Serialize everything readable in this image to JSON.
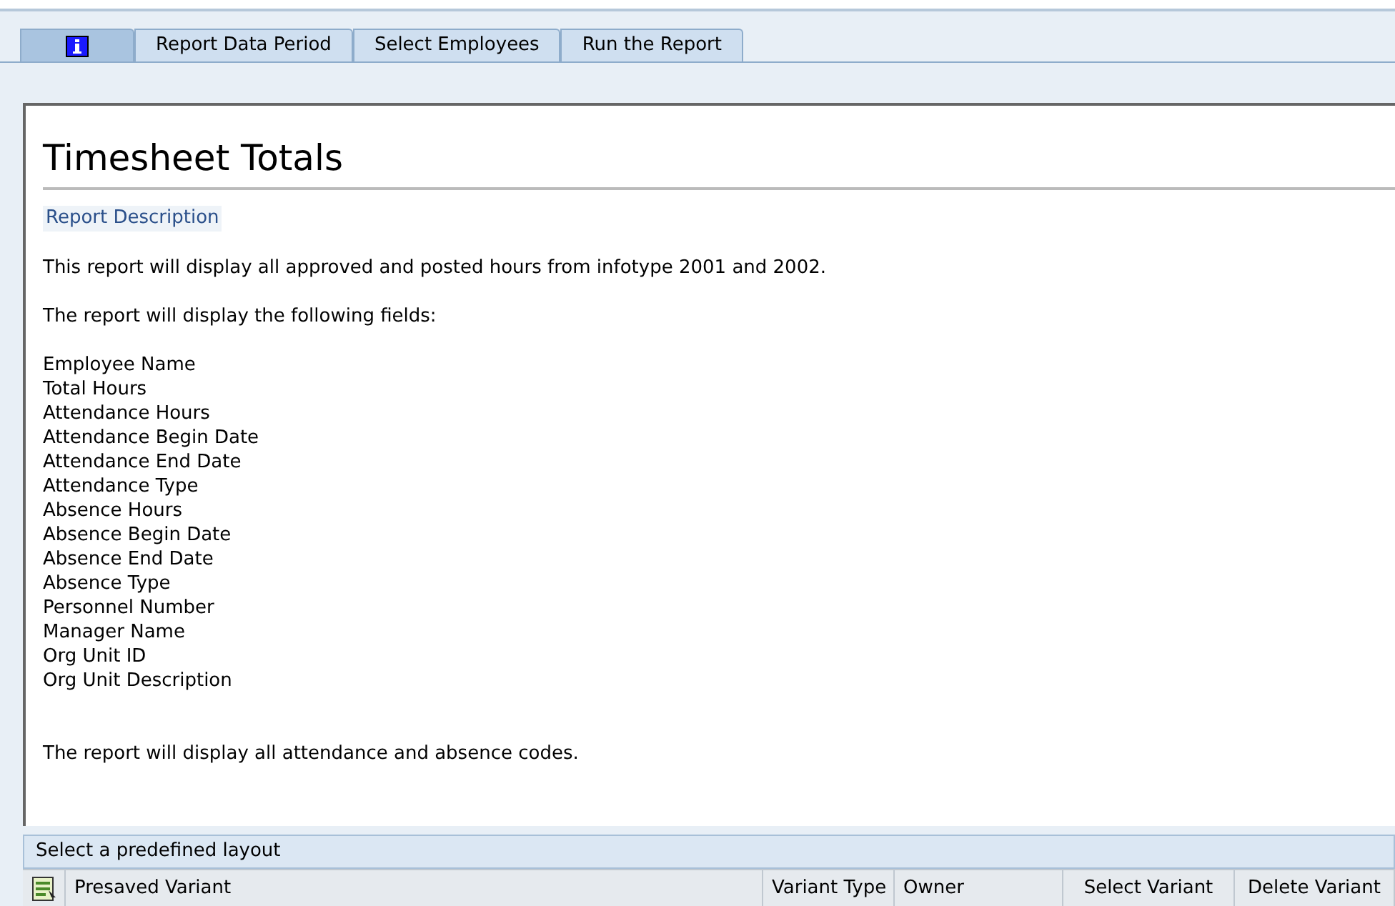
{
  "tabs": [
    {
      "kind": "icon",
      "selected": true
    },
    {
      "kind": "text",
      "label": "Report Data Period",
      "selected": false
    },
    {
      "kind": "text",
      "label": "Select Employees",
      "selected": false
    },
    {
      "kind": "text",
      "label": "Run the Report",
      "selected": false
    }
  ],
  "report": {
    "title": "Timesheet Totals",
    "section": "Report Description",
    "intro": "This report will display all approved and posted hours from infotype 2001 and 2002.",
    "fields_heading": "The report will display the following fields:",
    "fields": [
      "Employee Name",
      "Total Hours",
      "Attendance Hours",
      "Attendance Begin Date",
      "Attendance End Date",
      "Attendance Type",
      "Absence Hours",
      "Absence Begin Date",
      "Absence End Date",
      "Absence Type",
      "Personnel Number",
      "Manager Name",
      "Org Unit ID",
      "Org Unit Description"
    ],
    "closing": "The report will display all attendance and absence codes."
  },
  "layout_panel": {
    "title": "Select a predefined layout",
    "columns": [
      "Presaved Variant",
      "Variant Type",
      "Owner",
      "Select Variant",
      "Delete Variant"
    ]
  }
}
